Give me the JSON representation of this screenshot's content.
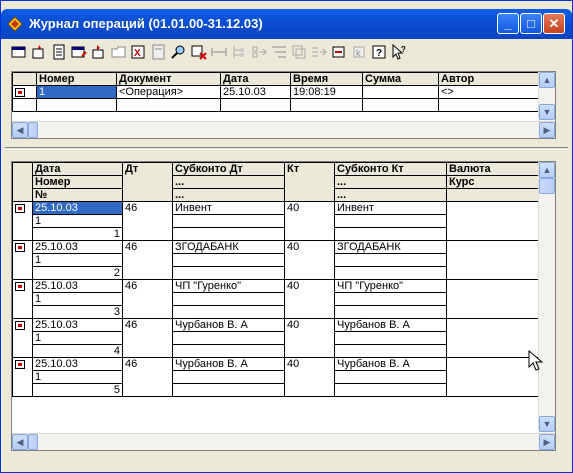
{
  "window": {
    "title": "Журнал операций (01.01.00-31.12.03)"
  },
  "controls": {
    "minimize": "_",
    "maximize": "□",
    "close": "✕"
  },
  "toolbar": {
    "icons": [
      "new-icon",
      "copy-icon",
      "document-icon",
      "edit-icon",
      "delete-icon",
      "folder-icon",
      "excel-icon",
      "doc-icon",
      "find-icon",
      "filter-icon",
      "interval-icon",
      "tree-icon",
      "move-icon",
      "sort-icon",
      "structure-icon",
      "post-icon",
      "unpost-icon",
      "journal-icon",
      "help-icon",
      "context-help-icon"
    ]
  },
  "top_grid": {
    "headers": [
      "",
      "Номер",
      "Документ",
      "Дата",
      "Время",
      "Сумма",
      "Автор"
    ],
    "row": {
      "number": "1",
      "document": "<Операция>",
      "date": "25.10.03",
      "time": "19:08:19",
      "sum": "",
      "author": "<>"
    }
  },
  "bottom_grid": {
    "headers": {
      "col1": [
        "Дата",
        "Номер",
        "№"
      ],
      "dt": "Дт",
      "subkonto_dt": [
        "Субконто Дт",
        "...",
        "..."
      ],
      "kt": "Кт",
      "subkonto_kt": [
        "Субконто Кт",
        "...",
        "..."
      ],
      "currency": [
        "Валюта",
        "Курс"
      ]
    },
    "rows": [
      {
        "date": "25.10.03",
        "number": "1",
        "n": "1",
        "dt": "46",
        "subkonto_dt": "Инвент",
        "kt": "40",
        "subkonto_kt": "Инвент"
      },
      {
        "date": "25.10.03",
        "number": "1",
        "n": "2",
        "dt": "46",
        "subkonto_dt": "ЗГОДАБАНК",
        "kt": "40",
        "subkonto_kt": "ЗГОДАБАНК"
      },
      {
        "date": "25.10.03",
        "number": "1",
        "n": "3",
        "dt": "46",
        "subkonto_dt": "ЧП \"Гуренко\"",
        "kt": "40",
        "subkonto_kt": "ЧП \"Гуренко\""
      },
      {
        "date": "25.10.03",
        "number": "1",
        "n": "4",
        "dt": "46",
        "subkonto_dt": "Чурбанов В. А",
        "kt": "40",
        "subkonto_kt": "Чурбанов В. А"
      },
      {
        "date": "25.10.03",
        "number": "1",
        "n": "5",
        "dt": "46",
        "subkonto_dt": "Чурбанов В. А",
        "kt": "40",
        "subkonto_kt": "Чурбанов В. А"
      }
    ]
  }
}
